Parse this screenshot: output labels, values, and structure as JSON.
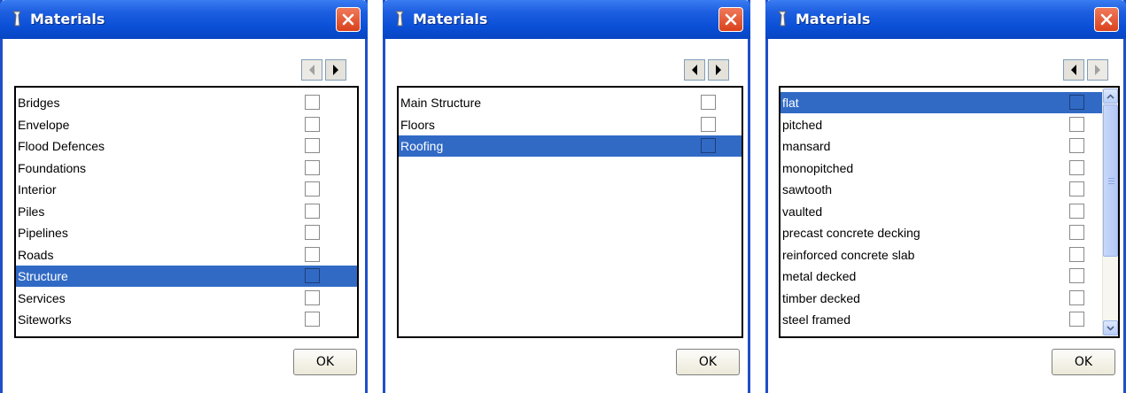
{
  "windows": [
    {
      "title": "Materials",
      "ok_label": "OK",
      "prev_enabled": false,
      "next_enabled": true,
      "items": [
        {
          "label": "Bridges",
          "selected": false
        },
        {
          "label": "Envelope",
          "selected": false
        },
        {
          "label": "Flood Defences",
          "selected": false
        },
        {
          "label": "Foundations",
          "selected": false
        },
        {
          "label": "Interior",
          "selected": false
        },
        {
          "label": "Piles",
          "selected": false
        },
        {
          "label": "Pipelines",
          "selected": false
        },
        {
          "label": "Roads",
          "selected": false
        },
        {
          "label": "Structure",
          "selected": true
        },
        {
          "label": "Services",
          "selected": false
        },
        {
          "label": "Siteworks",
          "selected": false
        }
      ]
    },
    {
      "title": "Materials",
      "ok_label": "OK",
      "prev_enabled": true,
      "next_enabled": true,
      "items": [
        {
          "label": "Main Structure",
          "selected": false
        },
        {
          "label": "Floors",
          "selected": false
        },
        {
          "label": "Roofing",
          "selected": true
        }
      ]
    },
    {
      "title": "Materials",
      "ok_label": "OK",
      "prev_enabled": true,
      "next_enabled": false,
      "has_scrollbar": true,
      "items": [
        {
          "label": "flat",
          "selected": true
        },
        {
          "label": "pitched",
          "selected": false
        },
        {
          "label": "mansard",
          "selected": false
        },
        {
          "label": "monopitched",
          "selected": false
        },
        {
          "label": "sawtooth",
          "selected": false
        },
        {
          "label": "vaulted",
          "selected": false
        },
        {
          "label": "precast concrete decking",
          "selected": false
        },
        {
          "label": "reinforced concrete slab",
          "selected": false
        },
        {
          "label": "metal decked",
          "selected": false
        },
        {
          "label": "timber decked",
          "selected": false
        },
        {
          "label": "steel framed",
          "selected": false
        }
      ]
    }
  ],
  "icons": {
    "app": "app-icon",
    "close": "close-icon",
    "prev": "arrow-left-icon",
    "next": "arrow-right-icon",
    "scroll_up": "chevron-up-icon",
    "scroll_down": "chevron-down-icon"
  },
  "colors": {
    "titlebar": "#0a4fd6",
    "selection": "#316ac5",
    "close_button": "#d9411c"
  }
}
